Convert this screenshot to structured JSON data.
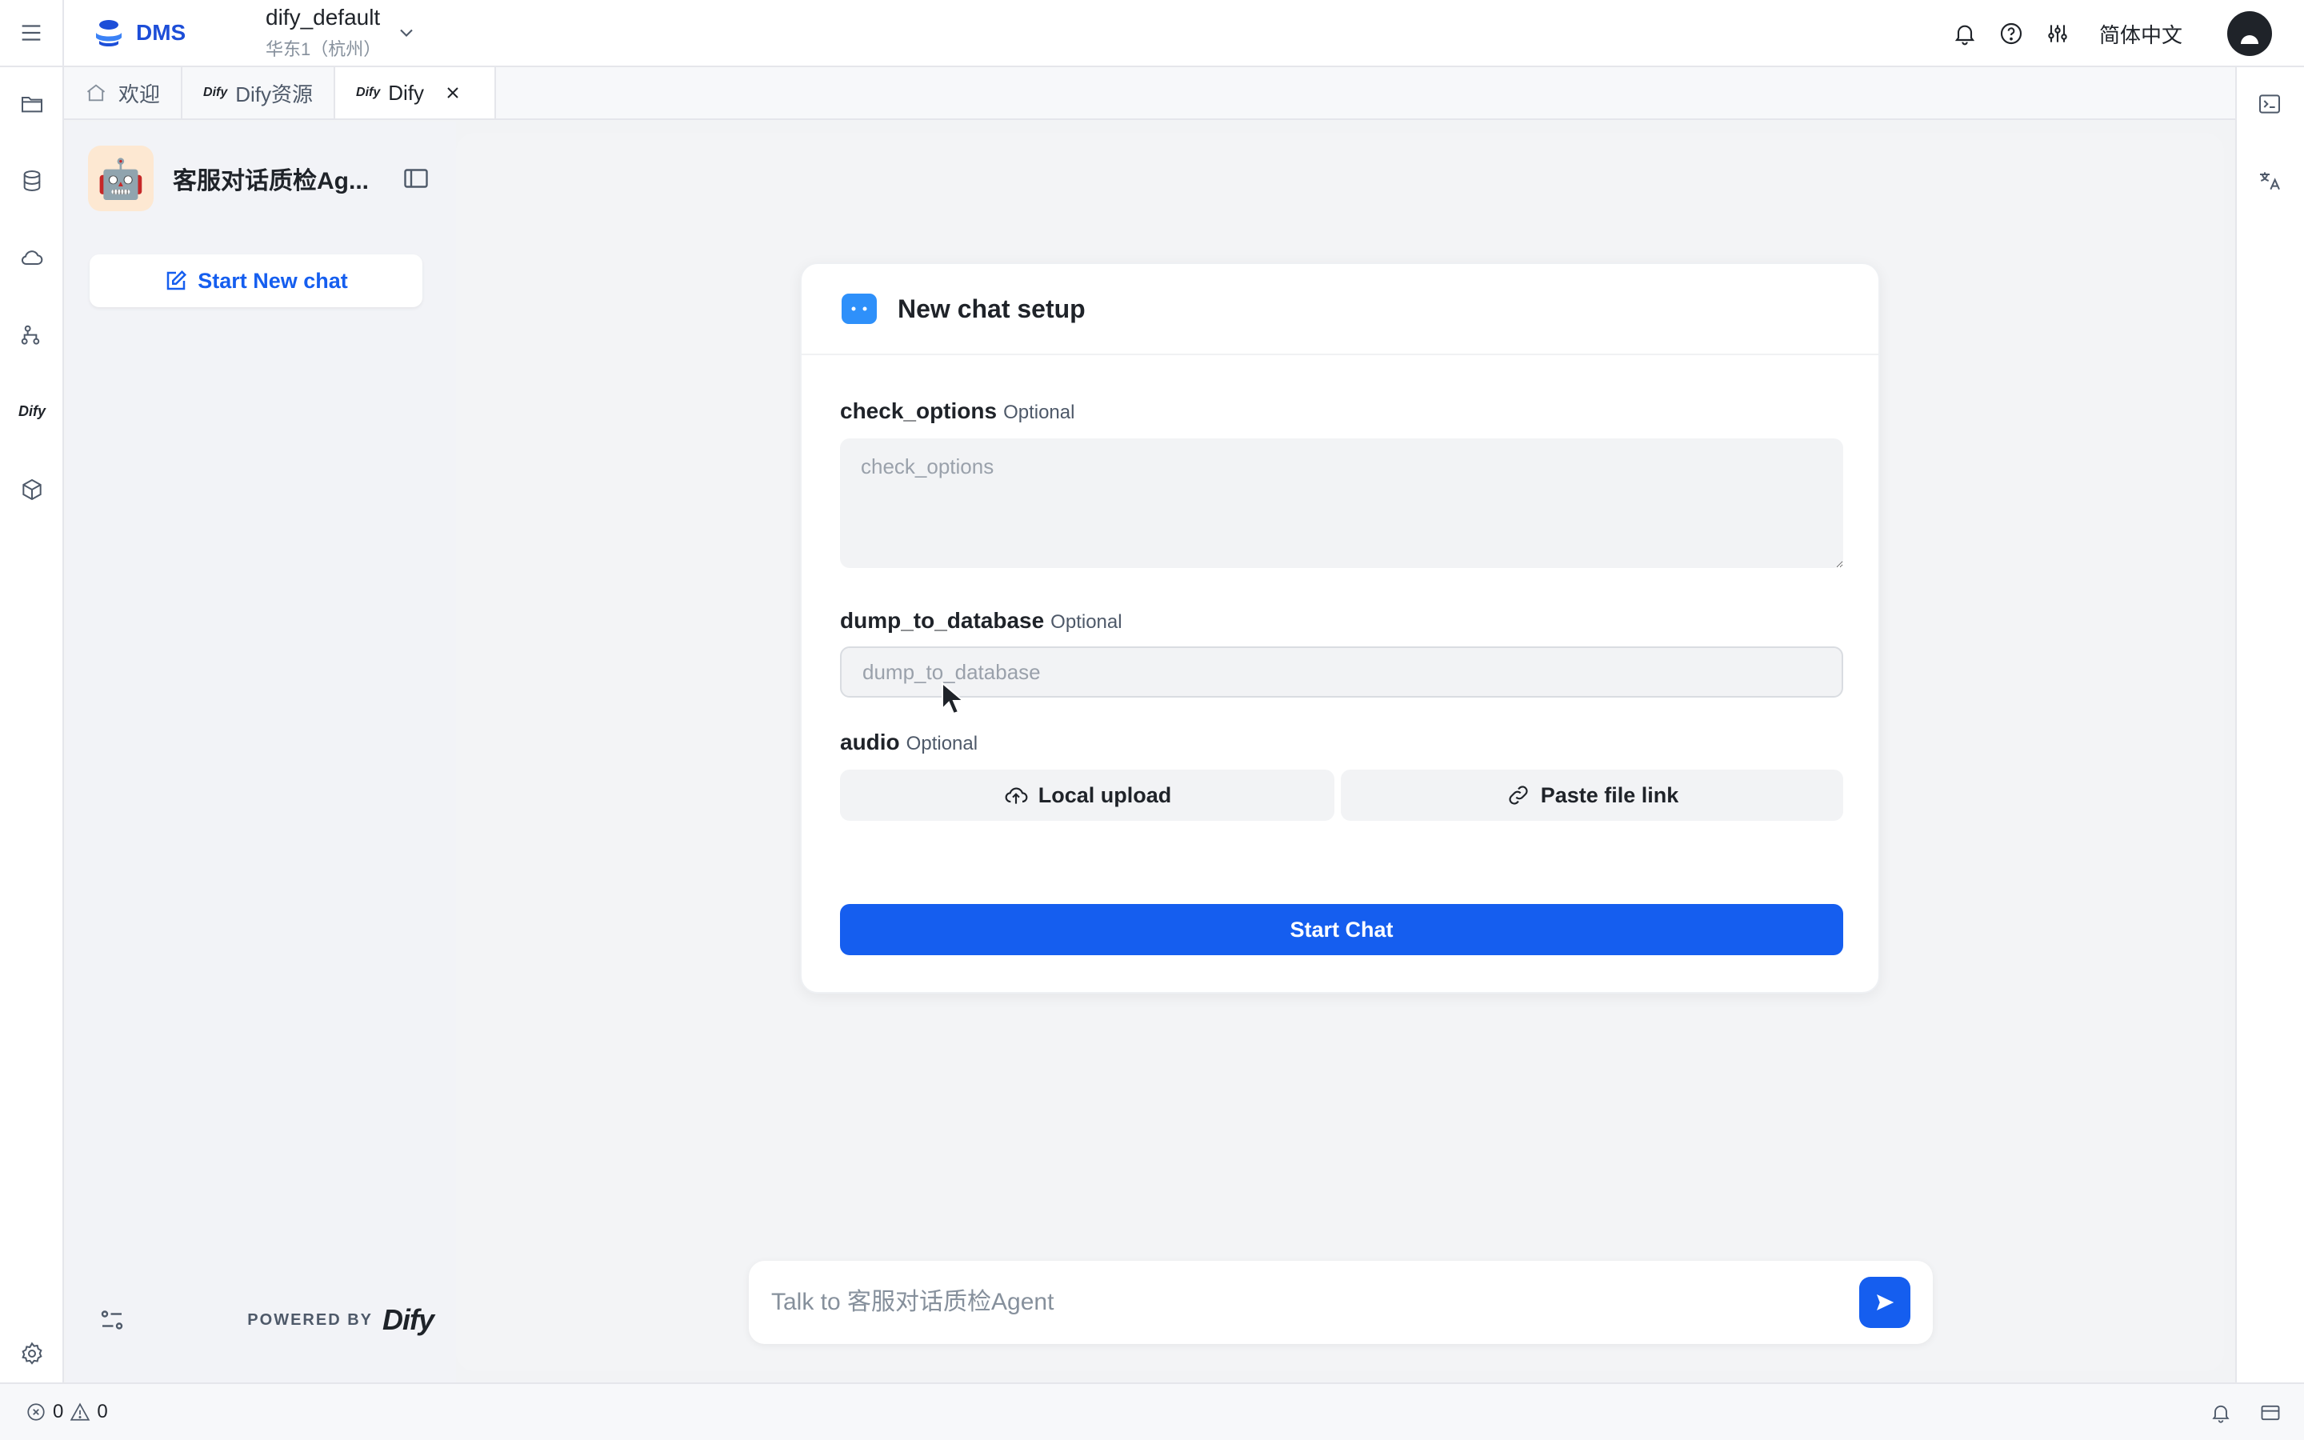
{
  "topbar": {
    "brand": "DMS",
    "workspace_name": "dify_default",
    "workspace_region": "华东1（杭州）",
    "language": "简体中文"
  },
  "tabs": [
    {
      "label": "欢迎"
    },
    {
      "label": "Dify资源",
      "mark": "Dify"
    },
    {
      "label": "Dify",
      "mark": "Dify",
      "active": true
    }
  ],
  "left_rail": {
    "dify_label": "Dify"
  },
  "sidebar": {
    "app_name": "客服对话质检Ag...",
    "app_avatar": "🤖",
    "new_chat_label": "Start New chat",
    "powered_by": "POWERED BY",
    "powered_logo": "Dify"
  },
  "setup": {
    "title": "New chat setup",
    "fields": [
      {
        "name": "check_options",
        "optional": "Optional",
        "placeholder": "check_options"
      },
      {
        "name": "dump_to_database",
        "optional": "Optional",
        "placeholder": "dump_to_database"
      },
      {
        "name": "audio",
        "optional": "Optional"
      }
    ],
    "local_upload_label": "Local upload",
    "paste_link_label": "Paste file link",
    "start_label": "Start Chat"
  },
  "chat": {
    "placeholder": "Talk to 客服对话质检Agent"
  },
  "statusbar": {
    "errors": "0",
    "warnings": "0"
  },
  "colors": {
    "accent": "#155eef",
    "brand": "#1d4ed8",
    "panel_bg": "#f3f4f6"
  }
}
